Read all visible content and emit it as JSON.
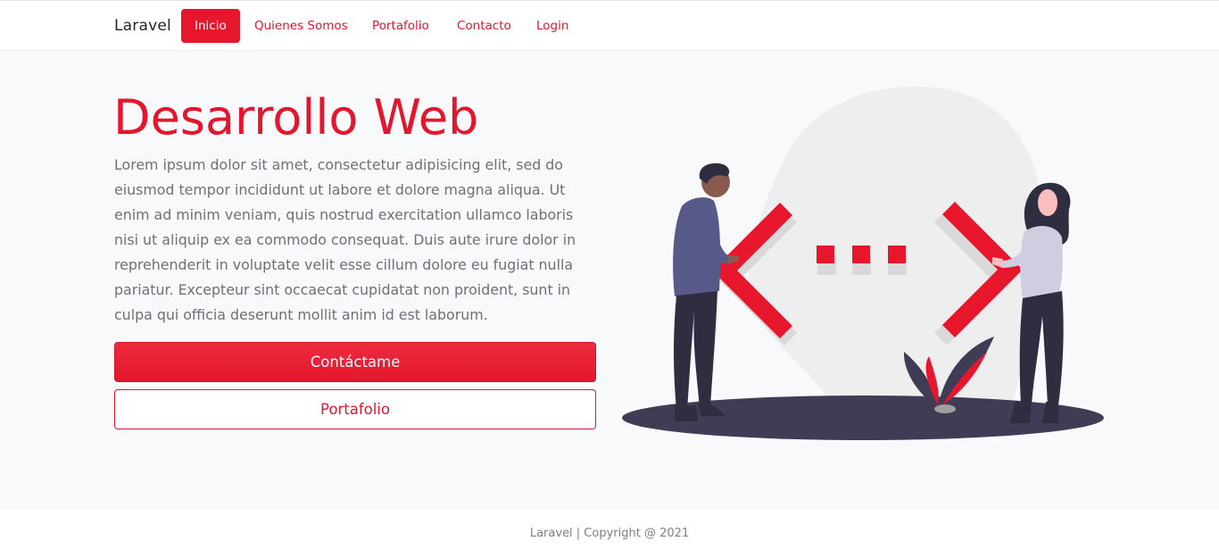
{
  "navbar": {
    "brand": "Laravel",
    "links": [
      {
        "label": "Inicio",
        "active": true
      },
      {
        "label": "Quienes Somos",
        "active": false
      },
      {
        "label": "Portafolio",
        "active": false
      },
      {
        "label": "Contacto",
        "active": false
      },
      {
        "label": "Login",
        "active": false
      }
    ]
  },
  "hero": {
    "title": "Desarrollo Web",
    "paragraph": "Lorem ipsum dolor sit amet, consectetur adipisicing elit, sed do eiusmod tempor incididunt ut labore et dolore magna aliqua. Ut enim ad minim veniam, quis nostrud exercitation ullamco laboris nisi ut aliquip ex ea commodo consequat. Duis aute irure dolor in reprehenderit in voluptate velit esse cillum dolore eu fugiat nulla pariatur. Excepteur sint occaecat cupidatat non proident, sunt in culpa qui officia deserunt mollit anim id est laborum.",
    "primary_button": "Contáctame",
    "secondary_button": "Portafolio"
  },
  "footer": {
    "text": "Laravel | Copyright @ 2021"
  },
  "colors": {
    "accent": "#e3162d",
    "hero_background": "#f8f9fb",
    "text_muted": "#6b7177",
    "illustration_dark": "#3f3d56"
  },
  "icons": {
    "illustration": "web-development-illustration"
  }
}
